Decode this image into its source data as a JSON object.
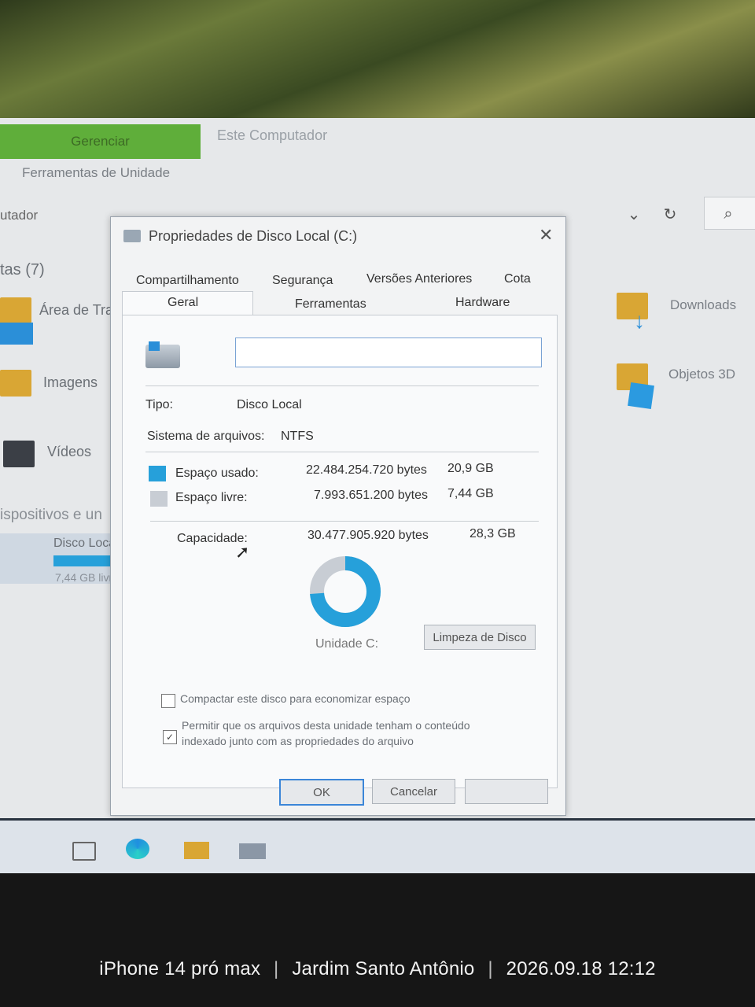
{
  "explorer": {
    "ribbon_tab_active": "Gerenciar",
    "ribbon_title": "Este Computador",
    "ribbon_subtitle": "Ferramentas de Unidade",
    "address_fragment": "utador",
    "nav": {
      "section_fragment": "tas (7)",
      "items": [
        "Área de Tra",
        "Imagens",
        "Vídeos"
      ],
      "devices_fragment": "ispositivos e un",
      "drive_label": "Disco Local",
      "drive_free_fragment": "7,44 GB livr"
    },
    "right_folders": [
      "Downloads",
      "Objetos 3D"
    ]
  },
  "dialog": {
    "title": "Propriedades de Disco Local (C:)",
    "tabs_row1": [
      "Compartilhamento",
      "Segurança",
      "Versões Anteriores",
      "Cota"
    ],
    "tabs_row2": [
      "Geral",
      "Ferramentas",
      "Hardware"
    ],
    "selected_tab": "Geral",
    "drive_name_value": "",
    "type_label": "Tipo:",
    "type_value": "Disco Local",
    "fs_label": "Sistema de arquivos:",
    "fs_value": "NTFS",
    "used_label": "Espaço usado:",
    "used_bytes": "22.484.254.720 bytes",
    "used_gb": "20,9 GB",
    "free_label": "Espaço livre:",
    "free_bytes": "7.993.651.200 bytes",
    "free_gb": "7,44 GB",
    "capacity_label": "Capacidade:",
    "capacity_bytes": "30.477.905.920 bytes",
    "capacity_gb": "28,3 GB",
    "used_fraction": 0.738,
    "drive_caption": "Unidade C:",
    "cleanup_button": "Limpeza de Disco",
    "compress_label": "Compactar este disco para economizar espaço",
    "compress_checked": false,
    "index_label_line1": "Permitir que os arquivos desta unidade tenham o conteúdo",
    "index_label_line2": "indexado junto com as propriedades do arquivo",
    "index_checked": true,
    "index_check_glyph": "✓",
    "ok_button": "OK",
    "cancel_button": "Cancelar",
    "colors": {
      "used": "#26a0da",
      "free": "#c8cdd4",
      "accent": "#3b86d8"
    }
  },
  "photo_stamp": {
    "device": "iPhone 14 pró max",
    "location": "Jardim Santo Antônio",
    "datetime": "2026.09.18 12:12"
  }
}
